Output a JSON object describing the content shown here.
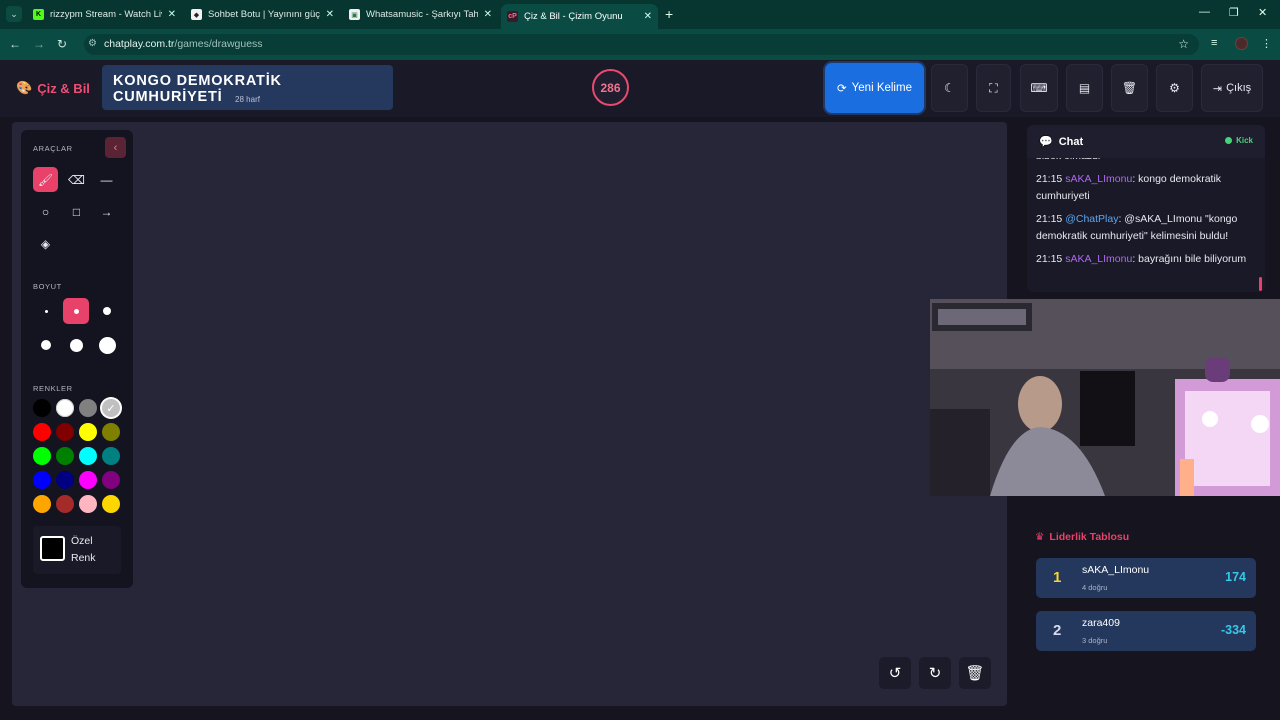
{
  "browser": {
    "tabs": [
      {
        "title": "rizzypm Stream - Watch Live on",
        "favicon": "kick-icon",
        "active": false
      },
      {
        "title": "Sohbet Botu | Yayınını güçlendir",
        "favicon": "bot-icon",
        "active": false
      },
      {
        "title": "Whatsamusic - Şarkıyı Tahmin Et",
        "favicon": "music-icon",
        "active": false
      },
      {
        "title": "Çiz & Bil - Çizim Oyunu",
        "favicon": "chatplay-icon",
        "active": true
      }
    ],
    "url_host": "chatplay.com.tr",
    "url_path": "/games/drawguess"
  },
  "header": {
    "logo": "Çiz & Bil",
    "word": "KONGO DEMOKRATİK CUMHURİYETİ",
    "word_hint": "28 harf",
    "timer": "286",
    "new_word_label": "Yeni Kelime",
    "exit_label": "Çıkış",
    "accent": "#e8416a",
    "primary": "#1a6ee0"
  },
  "tools": {
    "title": "ARAÇLAR",
    "size_title": "BOYUT",
    "colors_title": "RENKLER",
    "custom_color_line1": "Özel",
    "custom_color_line2": "Renk",
    "palette": [
      "#000000",
      "#ffffff",
      "#808080",
      "#c0c0c0",
      "#ff0000",
      "#800000",
      "#ffff00",
      "#808000",
      "#00ff00",
      "#008000",
      "#00ffff",
      "#008080",
      "#0000ff",
      "#000080",
      "#ff00ff",
      "#800080",
      "#ffa500",
      "#a52a2a",
      "#ffb6c1",
      "#ffd700"
    ]
  },
  "chat": {
    "title": "Chat",
    "platform": "Kick",
    "messages": [
      {
        "time": "",
        "user": "",
        "text": "bibok olmazdi"
      },
      {
        "time": "21:15",
        "user": "sAKA_LImonu",
        "text": ": kongo demokratik cumhuriyeti"
      },
      {
        "time": "21:15",
        "user": "@ChatPlay",
        "text": ": @sAKA_LImonu \"kongo demokratik cumhuriyeti\" kelimesini buldu!"
      },
      {
        "time": "21:15",
        "user": "sAKA_LImonu",
        "text": ": bayrağını bile biliyorum"
      }
    ]
  },
  "leaderboard": {
    "title": "Liderlik Tablosu",
    "rows": [
      {
        "rank": "1",
        "name": "sAKA_LImonu",
        "sub": "4 doğru",
        "score": "174"
      },
      {
        "rank": "2",
        "name": "zara409",
        "sub": "3 doğru",
        "score": "-334"
      }
    ]
  }
}
